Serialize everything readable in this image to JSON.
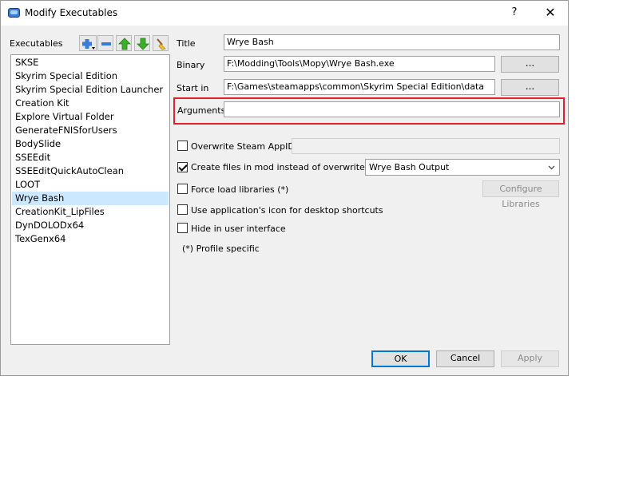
{
  "window": {
    "title": "Modify Executables",
    "help_label": "?",
    "close_label": "✕"
  },
  "executables": {
    "label": "Executables",
    "items": [
      "SKSE",
      "Skyrim Special Edition",
      "Skyrim Special Edition Launcher",
      "Creation Kit",
      "Explore Virtual Folder",
      "GenerateFNISforUsers",
      "BodySlide",
      "SSEEdit",
      "SSEEditQuickAutoClean",
      "LOOT",
      "Wrye Bash",
      "CreationKit_LipFiles",
      "DynDOLODx64",
      "TexGenx64"
    ],
    "selected": "Wrye Bash",
    "toolbar_icons": [
      "add-icon",
      "remove-icon",
      "move-up-icon",
      "move-down-icon",
      "clean-icon"
    ]
  },
  "form": {
    "title_label": "Title",
    "title_value": "Wrye Bash",
    "binary_label": "Binary",
    "binary_value": "F:\\Modding\\Tools\\Mopy\\Wrye Bash.exe",
    "start_in_label": "Start in",
    "start_in_value": "F:\\Games\\steamapps\\common\\Skyrim Special Edition\\data",
    "arguments_label": "Arguments",
    "arguments_value": "",
    "browse_label": "..."
  },
  "options": {
    "overwrite_appid_label": "Overwrite Steam AppID",
    "overwrite_appid_checked": false,
    "create_files_label": "Create files in mod instead of overwrite (*)",
    "create_files_checked": true,
    "create_files_mod": "Wrye Bash Output",
    "force_load_label": "Force load libraries (*)",
    "force_load_checked": false,
    "configure_libraries_label": "Configure Libraries",
    "use_icon_label": "Use application's icon for desktop shortcuts",
    "use_icon_checked": false,
    "hide_ui_label": "Hide in user interface",
    "hide_ui_checked": false,
    "profile_note": "(*) Profile specific"
  },
  "buttons": {
    "ok": "OK",
    "cancel": "Cancel",
    "apply": "Apply"
  },
  "colors": {
    "highlight_box": "#e0202a",
    "selection": "#cce8ff",
    "focus_border": "#0078d7"
  }
}
